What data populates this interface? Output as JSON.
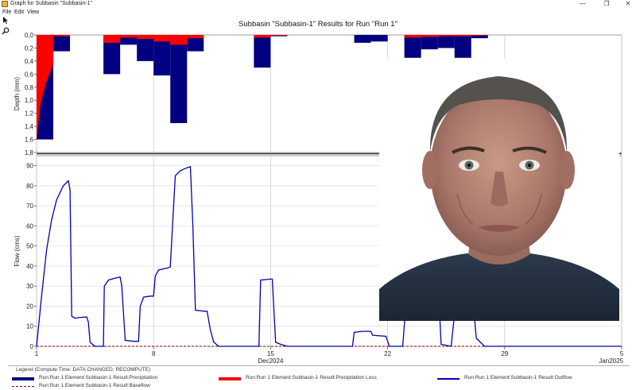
{
  "window": {
    "title": "Graph for Subbasin \"Subbasin-1\"",
    "controls": [
      "—",
      "❐",
      "✕"
    ]
  },
  "menu": {
    "items": [
      "File",
      "Edit",
      "View"
    ]
  },
  "tools": {
    "pointer": "pointer-icon",
    "zoom": "zoom-icon"
  },
  "colors": {
    "precip": "#000080",
    "loss": "#ff0000",
    "outflow": "#0000b4",
    "baseflow": "#8b0000"
  },
  "chart_data": [
    {
      "type": "bar",
      "title": "Subbasin \"Subbasin-1\" Results for Run \"Run 1\"",
      "ylabel": "Depth (mm)",
      "ylim": [
        1.8,
        0
      ],
      "yticks": [
        "0,0",
        "0,2",
        "0,4",
        "0,6",
        "0,8",
        "1,0",
        "1,2",
        "1,4",
        "1,6",
        "1,8"
      ],
      "series": [
        {
          "name": "Run:Run 1 Element:Subbasin-1 Result:Precipitation",
          "bars": [
            {
              "x0": 1,
              "x1": 2,
              "value": 1.6
            },
            {
              "x0": 2,
              "x1": 3,
              "value": 0.25
            },
            {
              "x0": 5,
              "x1": 6,
              "value": 0.6
            },
            {
              "x0": 6,
              "x1": 7,
              "value": 0.15
            },
            {
              "x0": 7,
              "x1": 8,
              "value": 0.4
            },
            {
              "x0": 8,
              "x1": 9,
              "value": 0.62
            },
            {
              "x0": 9,
              "x1": 10,
              "value": 1.35
            },
            {
              "x0": 10,
              "x1": 11,
              "value": 0.25
            },
            {
              "x0": 14,
              "x1": 15,
              "value": 0.5
            },
            {
              "x0": 15,
              "x1": 16,
              "value": 0.02
            },
            {
              "x0": 20,
              "x1": 21,
              "value": 0.12
            },
            {
              "x0": 21,
              "x1": 22,
              "value": 0.1
            },
            {
              "x0": 23,
              "x1": 24,
              "value": 0.35
            },
            {
              "x0": 24,
              "x1": 25,
              "value": 0.22
            },
            {
              "x0": 25,
              "x1": 26,
              "value": 0.2
            },
            {
              "x0": 26,
              "x1": 27,
              "value": 0.35
            },
            {
              "x0": 27,
              "x1": 28,
              "value": 0.05
            }
          ]
        },
        {
          "name": "Run:Run 1 Element:Subbasin-1 Result:Precipitation Loss",
          "bars": [
            {
              "x0": 1,
              "x1": 2,
              "value": 1.6
            },
            {
              "x0": 2,
              "x1": 3,
              "value": 0.02
            },
            {
              "x0": 5,
              "x1": 6,
              "value": 0.12
            },
            {
              "x0": 6,
              "x1": 7,
              "value": 0.04
            },
            {
              "x0": 7,
              "x1": 8,
              "value": 0.06
            },
            {
              "x0": 8,
              "x1": 9,
              "value": 0.1
            },
            {
              "x0": 9,
              "x1": 10,
              "value": 0.15
            },
            {
              "x0": 10,
              "x1": 11,
              "value": 0.05
            },
            {
              "x0": 14,
              "x1": 15,
              "value": 0.04
            },
            {
              "x0": 15,
              "x1": 16,
              "value": 0.01
            },
            {
              "x0": 23,
              "x1": 24,
              "value": 0.04
            },
            {
              "x0": 24,
              "x1": 25,
              "value": 0.03
            },
            {
              "x0": 25,
              "x1": 26,
              "value": 0.02
            },
            {
              "x0": 26,
              "x1": 27,
              "value": 0.02
            },
            {
              "x0": 27,
              "x1": 28,
              "value": 0.01
            }
          ]
        }
      ]
    },
    {
      "type": "line",
      "ylabel": "Flow (cms)",
      "xlim": [
        1,
        36
      ],
      "ylim": [
        0,
        95
      ],
      "yticks": [
        0,
        10,
        20,
        30,
        40,
        50,
        60,
        70,
        80,
        90
      ],
      "xticks": [
        {
          "x": 1,
          "label": "1"
        },
        {
          "x": 8,
          "label": "8"
        },
        {
          "x": 15,
          "label": "15"
        },
        {
          "x": 22,
          "label": "22"
        },
        {
          "x": 29,
          "label": "29"
        },
        {
          "x": 36,
          "label": "5"
        }
      ],
      "xgroup_labels": [
        {
          "x": 15,
          "label": "Dec2024"
        },
        {
          "x": 36,
          "label": "Jan2025"
        }
      ],
      "series": [
        {
          "name": "Run:Run 1 Element:Subbasin-1 Result:Outflow",
          "points": [
            [
              1,
              0
            ],
            [
              1.3,
              25
            ],
            [
              1.6,
              48
            ],
            [
              1.9,
              63
            ],
            [
              2.2,
              73
            ],
            [
              2.6,
              80
            ],
            [
              2.9,
              82.5
            ],
            [
              3.0,
              78
            ],
            [
              3.1,
              15
            ],
            [
              3.3,
              14
            ],
            [
              3.6,
              14.4
            ],
            [
              4.0,
              14.6
            ],
            [
              4.1,
              12
            ],
            [
              4.2,
              2
            ],
            [
              4.5,
              0
            ],
            [
              5.0,
              0
            ],
            [
              5.05,
              30
            ],
            [
              5.3,
              33
            ],
            [
              5.7,
              34
            ],
            [
              6.0,
              34.5
            ],
            [
              6.1,
              30
            ],
            [
              6.3,
              3
            ],
            [
              6.8,
              2.5
            ],
            [
              7.1,
              2.5
            ],
            [
              7.2,
              20
            ],
            [
              7.4,
              24.5
            ],
            [
              7.8,
              25
            ],
            [
              8.0,
              25
            ],
            [
              8.1,
              35
            ],
            [
              8.3,
              38
            ],
            [
              8.8,
              39
            ],
            [
              9.0,
              39.5
            ],
            [
              9.1,
              55
            ],
            [
              9.3,
              85
            ],
            [
              9.6,
              87.5
            ],
            [
              10.0,
              89
            ],
            [
              10.2,
              89.5
            ],
            [
              10.35,
              60
            ],
            [
              10.5,
              18
            ],
            [
              11.0,
              17.5
            ],
            [
              11.2,
              17.5
            ],
            [
              11.4,
              8
            ],
            [
              11.6,
              2
            ],
            [
              11.9,
              0
            ],
            [
              14.3,
              0
            ],
            [
              14.4,
              33
            ],
            [
              15.0,
              33.5
            ],
            [
              15.1,
              33.5
            ],
            [
              15.3,
              2
            ],
            [
              15.6,
              1
            ],
            [
              16.0,
              0
            ],
            [
              19.9,
              0
            ],
            [
              20.0,
              7
            ],
            [
              20.5,
              7.5
            ],
            [
              21.0,
              7.5
            ],
            [
              21.1,
              5.5
            ],
            [
              21.9,
              5
            ],
            [
              22.1,
              0
            ],
            [
              22.9,
              0
            ],
            [
              23.2,
              32
            ],
            [
              23.5,
              33
            ],
            [
              24.5,
              34
            ],
            [
              25.0,
              34.5
            ],
            [
              25.2,
              1
            ],
            [
              25.8,
              0
            ],
            [
              26.2,
              32
            ],
            [
              26.6,
              33
            ],
            [
              27.0,
              33
            ],
            [
              27.3,
              4
            ],
            [
              27.8,
              0
            ],
            [
              36,
              0
            ]
          ]
        },
        {
          "name": "Run:Run 1 Element:Subbasin-1 Result:Baseflow",
          "points": [
            [
              1,
              0
            ],
            [
              36,
              0
            ]
          ]
        }
      ]
    }
  ],
  "legend": {
    "title": "Legend (Compute Time: DATA CHANGED, RECOMPUTE)",
    "items": [
      "Run:Run 1 Element:Subbasin-1 Result:Precipitation",
      "Run:Run 1 Element:Subbasin-1 Result:Precipitation Loss",
      "Run:Run 1 Element:Subbasin-1 Result:Outflow",
      "Run:Run 1 Element:Subbasin-1 Result:Baseflow"
    ]
  },
  "overlay": {
    "photo": "portrait-photo"
  }
}
